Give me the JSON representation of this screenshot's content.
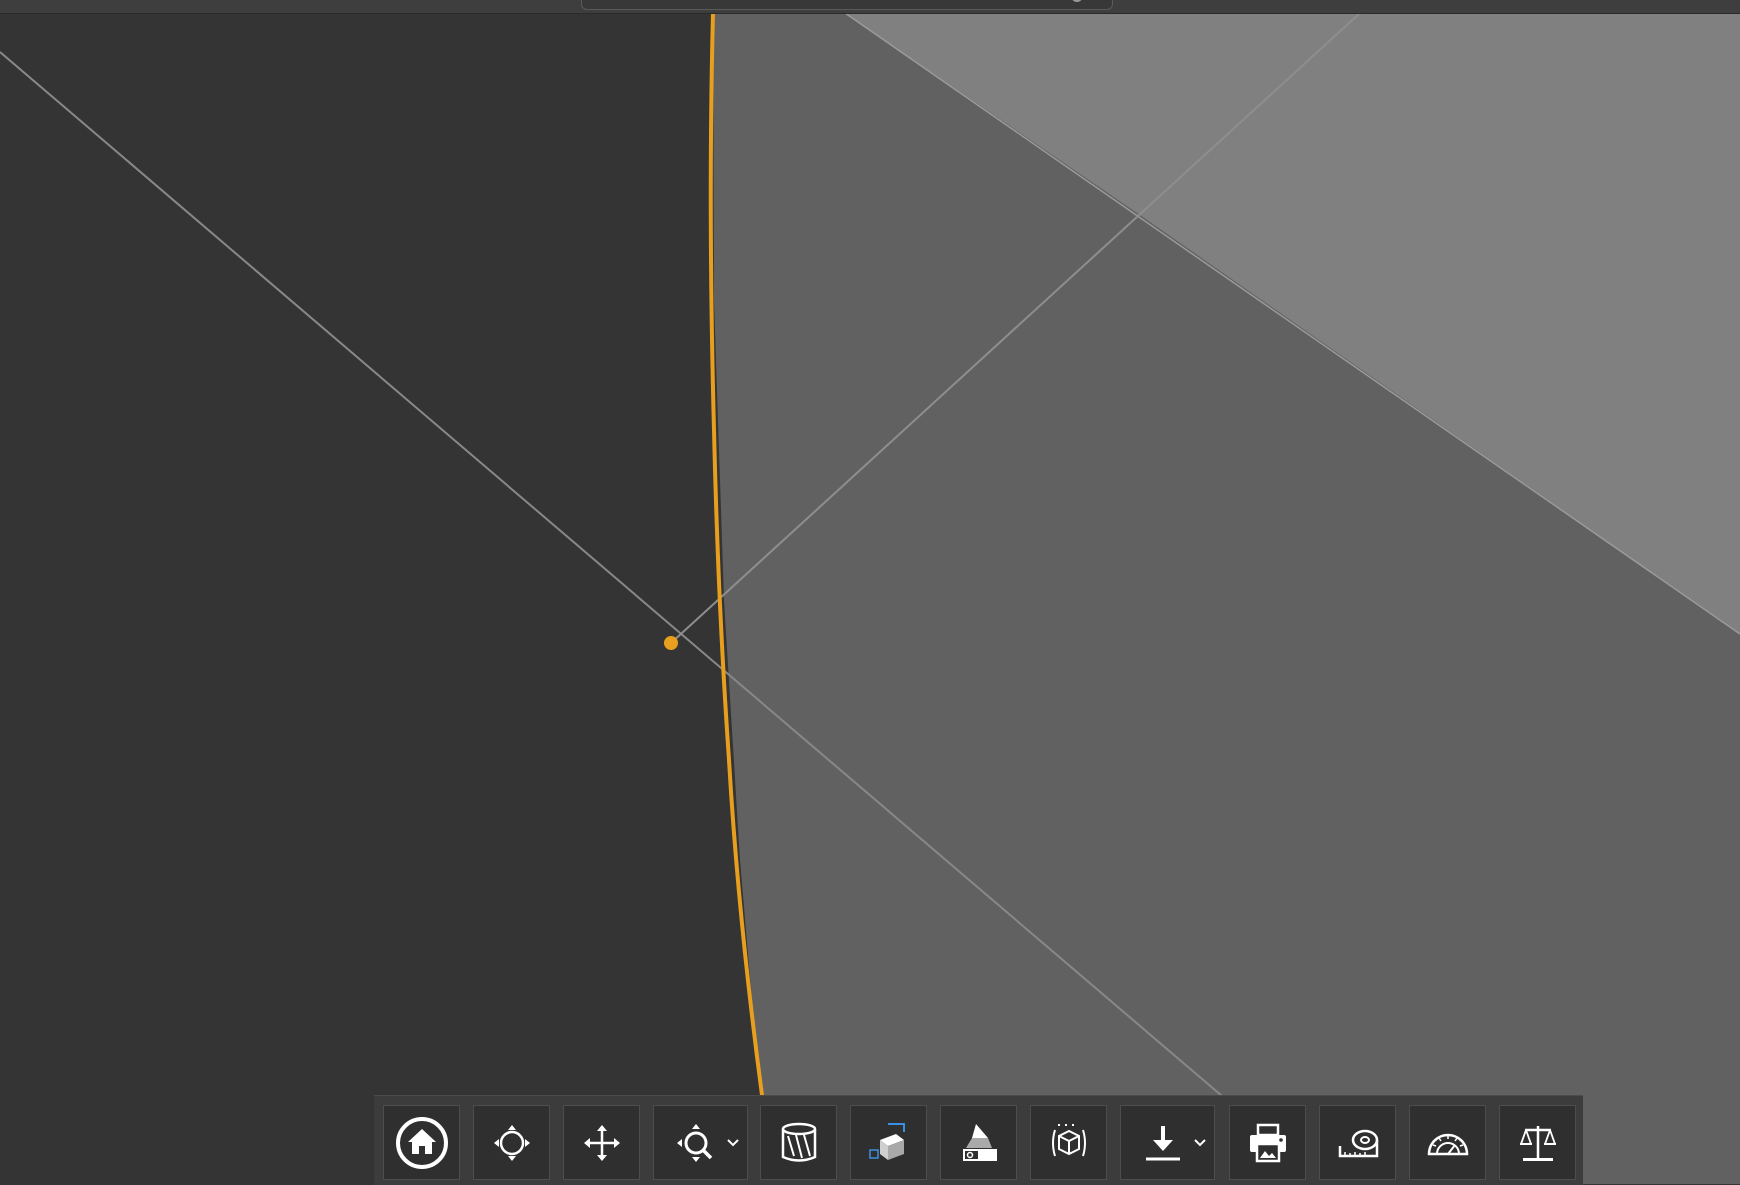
{
  "viewport": {
    "background_color": "#343434",
    "surface_colors": [
      "#616162",
      "#808081"
    ],
    "edge_color": "#e89f1e"
  },
  "top_bar": {
    "tab_indicator": "knob-icon"
  },
  "toolbar": {
    "buttons": [
      {
        "id": "home",
        "icon": "home-icon"
      },
      {
        "id": "orbit",
        "icon": "orbit-icon"
      },
      {
        "id": "pan",
        "icon": "pan-icon"
      },
      {
        "id": "zoom",
        "icon": "zoom-icon",
        "has_dropdown": true
      },
      {
        "id": "section",
        "icon": "section-analysis-icon"
      },
      {
        "id": "model-browser",
        "icon": "model-browser-icon"
      },
      {
        "id": "explode",
        "icon": "explode-model-icon"
      },
      {
        "id": "model-views",
        "icon": "model-views-icon"
      },
      {
        "id": "download",
        "icon": "download-icon",
        "has_dropdown": true
      },
      {
        "id": "print",
        "icon": "print-icon"
      },
      {
        "id": "measure",
        "icon": "measure-tape-icon"
      },
      {
        "id": "angle",
        "icon": "protractor-icon"
      },
      {
        "id": "properties",
        "icon": "balance-scale-icon"
      }
    ]
  }
}
